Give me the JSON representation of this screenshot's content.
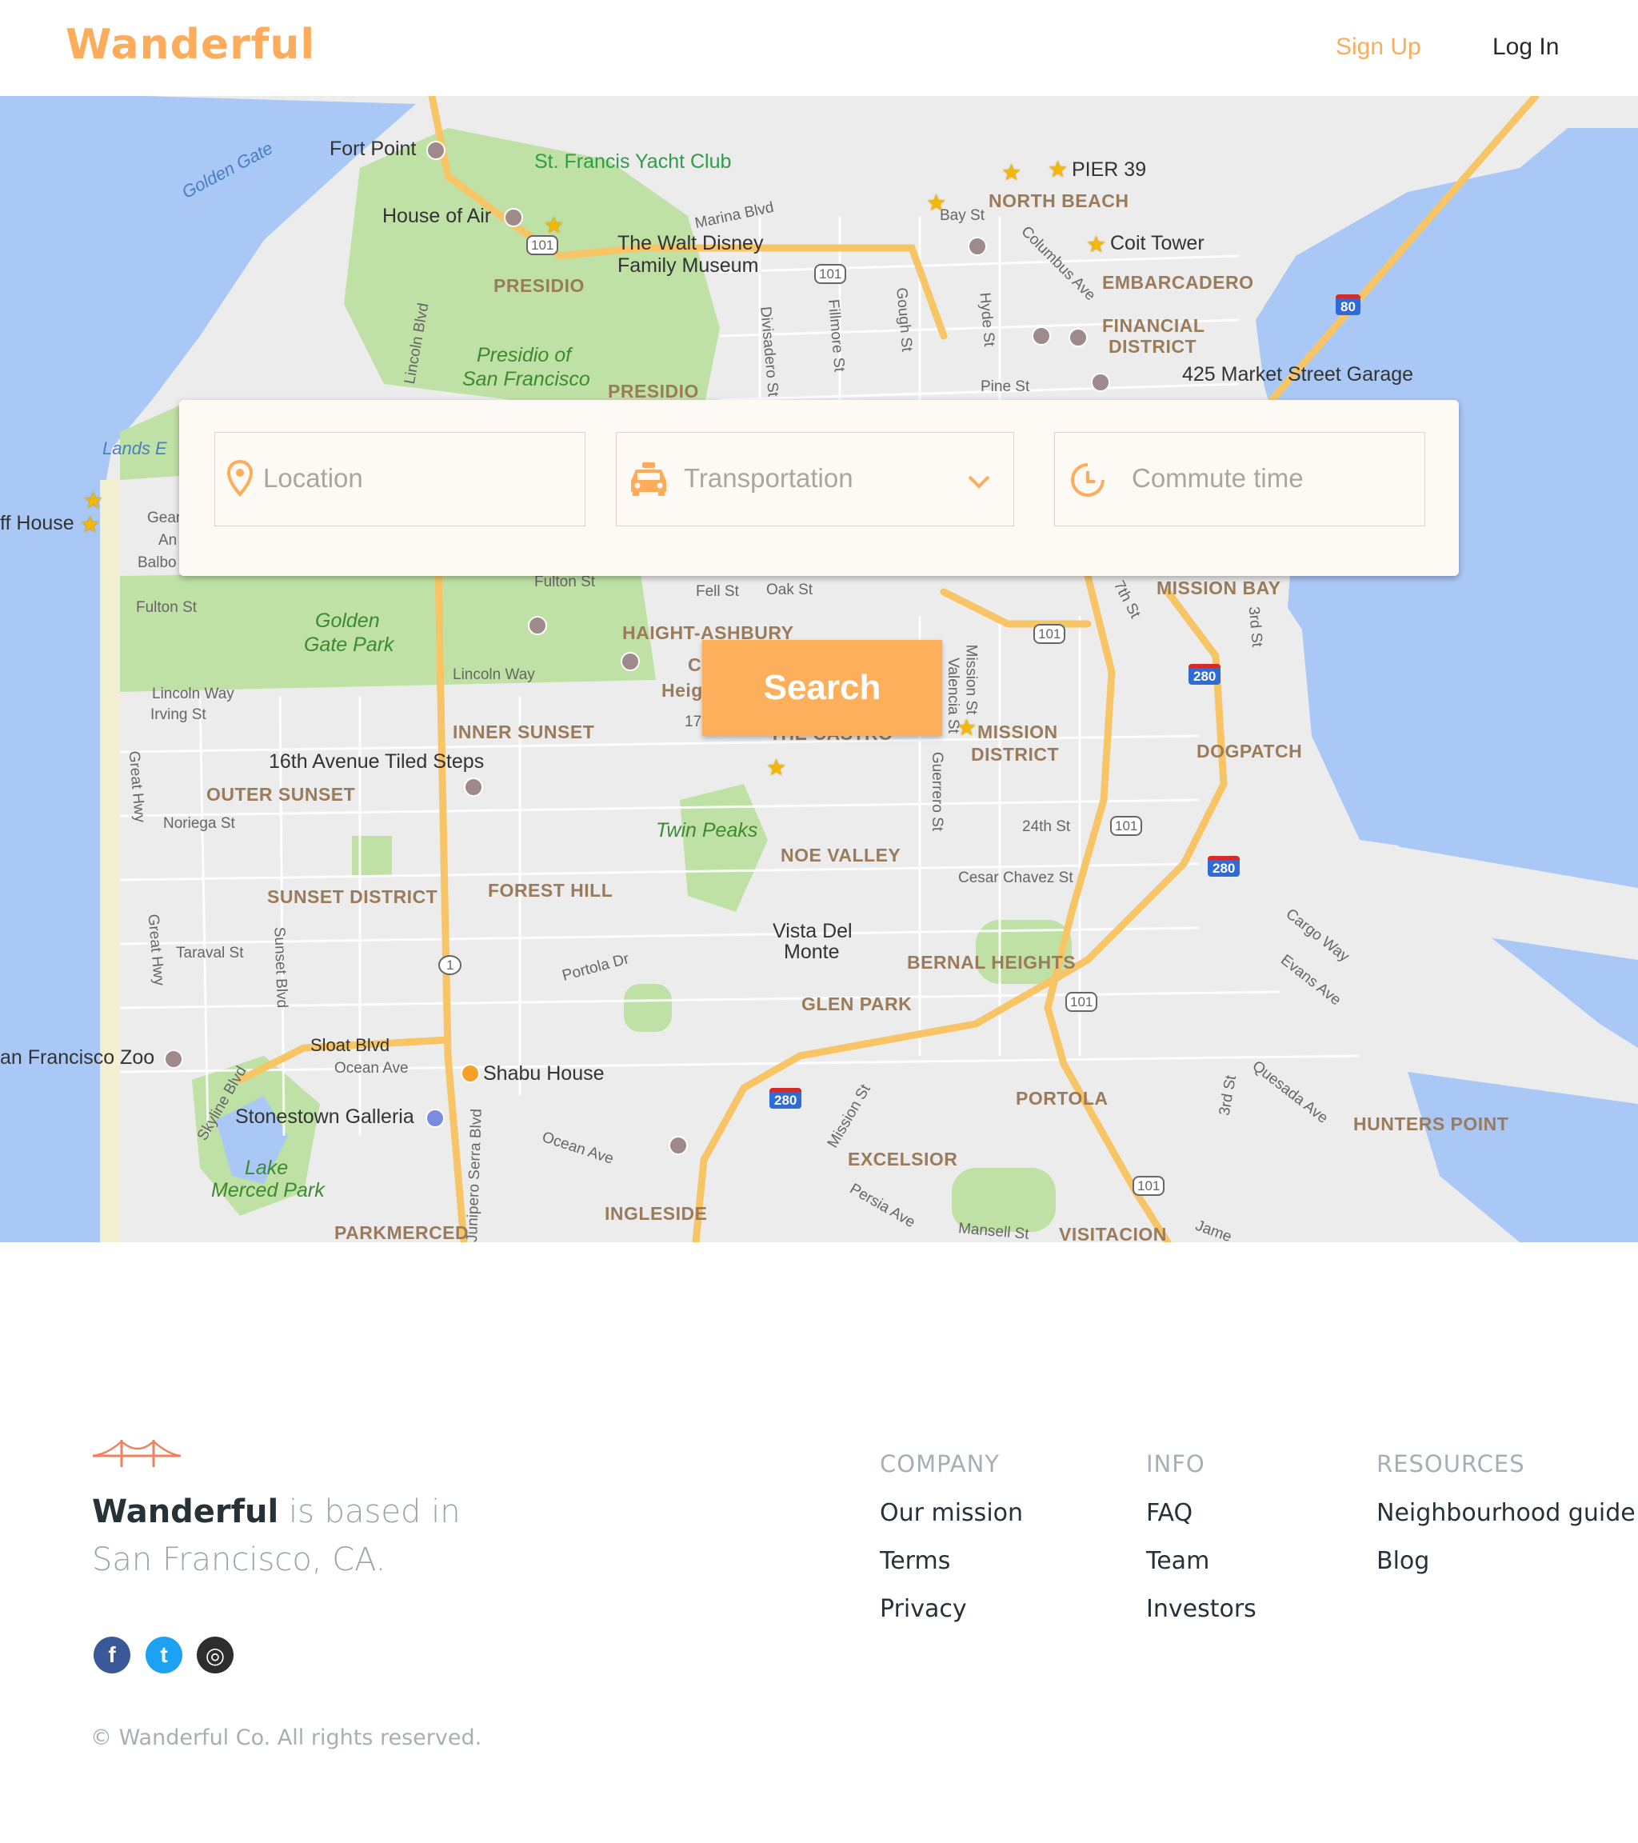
{
  "header": {
    "logo": "Wanderful",
    "signup_label": "Sign Up",
    "login_label": "Log In",
    "accent_color": "#fcac5b"
  },
  "search": {
    "location_placeholder": "Location",
    "transport_placeholder": "Transportation",
    "commute_placeholder": "Commute time",
    "button_label": "Search",
    "icons": [
      "location-pin-icon",
      "taxi-icon",
      "chevron-down-icon",
      "clock-icon"
    ]
  },
  "map": {
    "labels": {
      "fort_point": "Fort Point",
      "golden_gate": "Golden Gate",
      "yacht_club": "St. Francis Yacht Club",
      "marina_blvd": "Marina Blvd",
      "house_of_air": "House of Air",
      "walt_disney": "The Walt Disney",
      "walt_disney_2": "Family Museum",
      "presidio": "PRESIDIO",
      "presidio_sf": "Presidio of",
      "presidio_sf_2": "San Francisco",
      "presidio_2": "PRESIDIO",
      "lincoln_blvd": "Lincoln Blvd",
      "divisadero": "Divisadero St",
      "fillmore": "Fillmore St",
      "gough": "Gough St",
      "hyde": "Hyde St",
      "bay_st": "Bay St",
      "pier39": "PIER 39",
      "north_beach": "NORTH BEACH",
      "columbus": "Columbus Ave",
      "coit_tower": "Coit Tower",
      "embarcadero": "EMBARCADERO",
      "financial": "FINANCIAL",
      "financial_2": "DISTRICT",
      "pine_st": "Pine St",
      "market_garage": "425 Market Street Garage",
      "lands_end": "Lands E",
      "cliff_house": "ff House",
      "gear": "Gear",
      "an": "An",
      "balbo": "Balbo",
      "fulton_st": "Fulton St",
      "fulton_st_2": "Fulton St",
      "fell_st": "Fell St",
      "oak_st": "Oak St",
      "golden_gate_park": "Golden",
      "golden_gate_park_2": "Gate Park",
      "haight": "HAIGHT-ASHBURY",
      "mission_bay": "MISSION BAY",
      "seventh": "7th St",
      "third_st": "3rd St",
      "lincoln_way": "Lincoln Way",
      "lincoln_way_2": "Lincoln Way",
      "irving": "Irving St",
      "inner_sunset": "INNER SUNSET",
      "tiled_steps": "16th Avenue Tiled Steps",
      "outer_sunset": "OUTER SUNSET",
      "noriega": "Noriega St",
      "great_hwy": "Great Hwy",
      "great_hwy_2": "Great Hwy",
      "mission_st": "Mission St",
      "valencia": "Valencia St",
      "guerrero": "Guerrero St",
      "mission_district": "MISSION",
      "mission_district_2": "DISTRICT",
      "dogpatch": "DOGPATCH",
      "twin_peaks": "Twin Peaks",
      "noe_valley": "NOE VALLEY",
      "st24": "24th St",
      "cesar_chavez": "Cesar Chavez St",
      "sunset_district": "SUNSET DISTRICT",
      "forest_hill": "FOREST HILL",
      "taraval": "Taraval St",
      "sunset_blvd": "Sunset Blvd",
      "portola_dr": "Portola Dr",
      "vista_del_monte": "Vista Del",
      "vista_del_monte_2": "Monte",
      "bernal": "BERNAL HEIGHTS",
      "glen_park": "GLEN PARK",
      "cargo_way": "Cargo Way",
      "evans": "Evans Ave",
      "sf_zoo": "an Francisco Zoo",
      "sloat": "Sloat Blvd",
      "ocean_ave": "Ocean Ave",
      "ocean_ave_2": "Ocean Ave",
      "shabu": "Shabu House",
      "skyline": "Skyline Blvd",
      "stonestown": "Stonestown Galleria",
      "lake_merced": "Lake",
      "lake_merced_2": "Merced Park",
      "junipero": "Junipero Serra Blvd",
      "parkmerced": "PARKMERCED",
      "ingleside": "INGLESIDE",
      "excelsior": "EXCELSIOR",
      "portola": "PORTOLA",
      "mission_st_2": "Mission St",
      "persia": "Persia Ave",
      "mansell": "Mansell St",
      "visitacion": "VISITACION",
      "third_st_2": "3rd St",
      "quesada": "Quesada Ave",
      "hunters_point": "HUNTERS POINT",
      "jamestown": "Jame",
      "hwy_101": "101",
      "hwy_80": "80",
      "hwy_280": "280",
      "hwy_1": "1",
      "partial_c": "C",
      "partial_heig": "Heig",
      "partial_17": "17",
      "partial_castro": "THE CASTRO"
    }
  },
  "footer": {
    "brand": "Wanderful",
    "about_rest": " is based in",
    "about_city": "San Francisco, CA.",
    "company_head": "COMPANY",
    "info_head": "INFO",
    "resources_head": "RESOURCES",
    "company_links": [
      "Our mission",
      "Terms",
      "Privacy"
    ],
    "info_links": [
      "FAQ",
      "Team",
      "Investors"
    ],
    "resources_links": [
      "Neighbourhood guide",
      "Blog"
    ],
    "social": {
      "facebook": "f",
      "twitter": "t",
      "instagram": "◎"
    },
    "copyright": "© Wanderful Co. All rights reserved."
  }
}
